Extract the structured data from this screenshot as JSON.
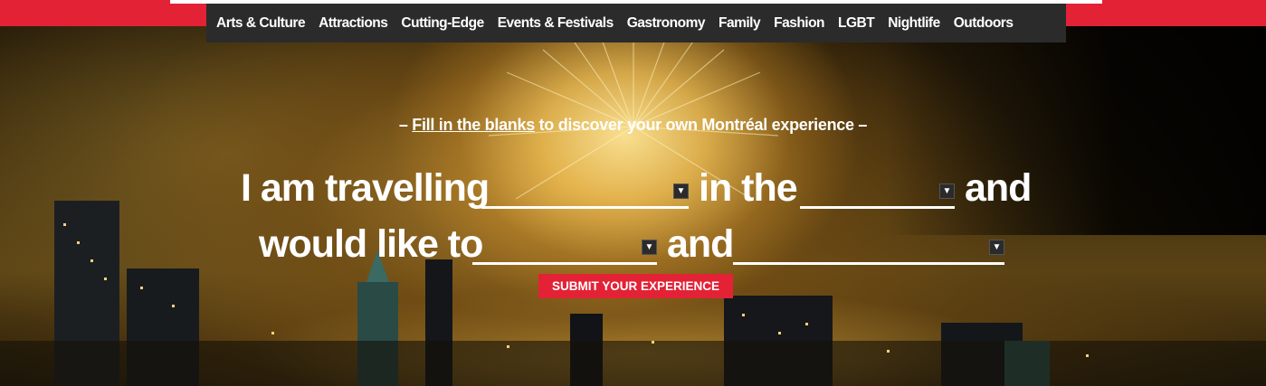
{
  "nav": {
    "items": [
      {
        "label": "Arts & Culture"
      },
      {
        "label": "Attractions"
      },
      {
        "label": "Cutting-Edge"
      },
      {
        "label": "Events & Festivals"
      },
      {
        "label": "Gastronomy"
      },
      {
        "label": "Family"
      },
      {
        "label": "Fashion"
      },
      {
        "label": "LGBT"
      },
      {
        "label": "Nightlife"
      },
      {
        "label": "Outdoors"
      }
    ]
  },
  "tagline": {
    "dash_left": "–",
    "link": "Fill in the blanks",
    "rest": "to discover your own Montréal experience",
    "dash_right": "–"
  },
  "form": {
    "line1_part1": "I am travelling",
    "line1_part2": "in the",
    "line1_part3": "and",
    "line2_part1": "would like to",
    "line2_part2": "and",
    "selects": [
      {
        "value": ""
      },
      {
        "value": ""
      },
      {
        "value": ""
      },
      {
        "value": ""
      }
    ],
    "submit_label": "SUBMIT YOUR EXPERIENCE"
  },
  "colors": {
    "brand_red": "#e32236",
    "nav_bg": "#2b2b2b",
    "text": "#ffffff"
  },
  "icons": {
    "dropdown": "chevron-down-icon"
  }
}
